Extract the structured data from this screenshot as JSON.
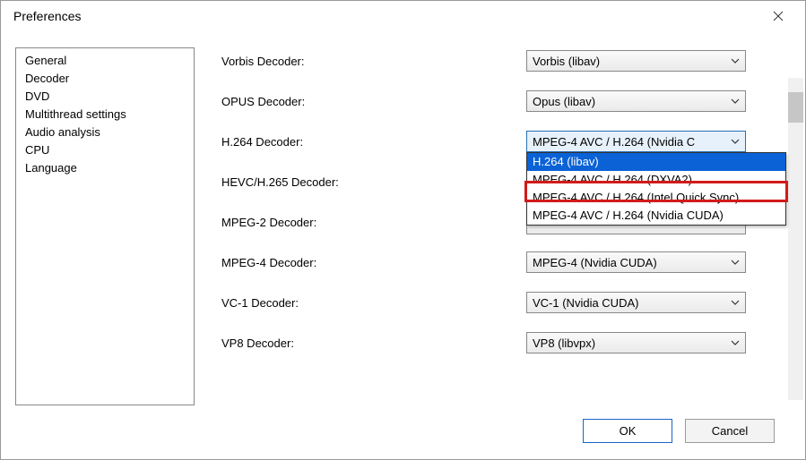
{
  "window": {
    "title": "Preferences"
  },
  "sidebar": {
    "items": [
      {
        "label": "General"
      },
      {
        "label": "Decoder"
      },
      {
        "label": "DVD"
      },
      {
        "label": "Multithread settings"
      },
      {
        "label": "Audio analysis"
      },
      {
        "label": "CPU"
      },
      {
        "label": "Language"
      }
    ]
  },
  "settings": {
    "vorbis": {
      "label": "Vorbis Decoder:",
      "value": "Vorbis (libav)"
    },
    "opus": {
      "label": "OPUS Decoder:",
      "value": "Opus (libav)"
    },
    "h264": {
      "label": "H.264 Decoder:",
      "value": "MPEG-4 AVC / H.264 (Nvidia CUDA)",
      "value_display_truncated": "MPEG-4 AVC / H.264 (Nvidia C",
      "options": [
        "H.264 (libav)",
        "MPEG-4 AVC / H.264  (DXVA2)",
        "MPEG-4 AVC / H.264  (Intel Quick Sync)",
        "MPEG-4 AVC / H.264 (Nvidia CUDA)"
      ],
      "open": true,
      "highlighted_index": 0,
      "emphasized_index": 3
    },
    "hevc": {
      "label": "HEVC/H.265 Decoder:",
      "value": ""
    },
    "mpeg2": {
      "label": "MPEG-2 Decoder:",
      "value": ""
    },
    "mpeg4": {
      "label": "MPEG-4 Decoder:",
      "value": "MPEG-4 (Nvidia CUDA)"
    },
    "vc1": {
      "label": "VC-1 Decoder:",
      "value": "VC-1 (Nvidia CUDA)"
    },
    "vp8": {
      "label": "VP8 Decoder:",
      "value": "VP8 (libvpx)"
    }
  },
  "buttons": {
    "ok": "OK",
    "cancel": "Cancel"
  }
}
